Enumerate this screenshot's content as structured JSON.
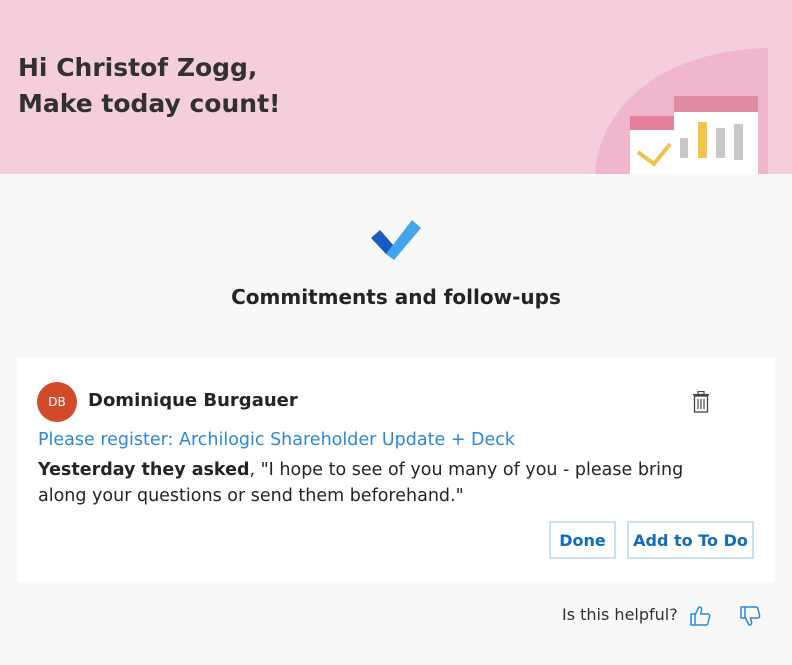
{
  "header": {
    "greeting_line1": "Hi Christof Zogg,",
    "greeting_line2": "Make today count!"
  },
  "section": {
    "title": "Commitments and follow-ups",
    "icon": "todo-checkmark-icon"
  },
  "card": {
    "avatar_initials": "DB",
    "avatar_color": "#d14a2a",
    "sender": "Dominique Burgauer",
    "subject": "Please register: Archilogic Shareholder Update + Deck",
    "lead": "Yesterday they asked",
    "body": ", \"I hope to see of you many of you - please bring along your questions or send them beforehand.\"",
    "done_label": "Done",
    "add_label": "Add to To Do",
    "delete_icon": "trash-icon"
  },
  "feedback": {
    "question": "Is this helpful?",
    "up_icon": "thumbs-up-icon",
    "down_icon": "thumbs-down-icon"
  },
  "colors": {
    "header_bg": "#f4cedd",
    "link": "#2b88d8",
    "button_text": "#0f6cbd",
    "button_border": "#c7e0f4"
  }
}
